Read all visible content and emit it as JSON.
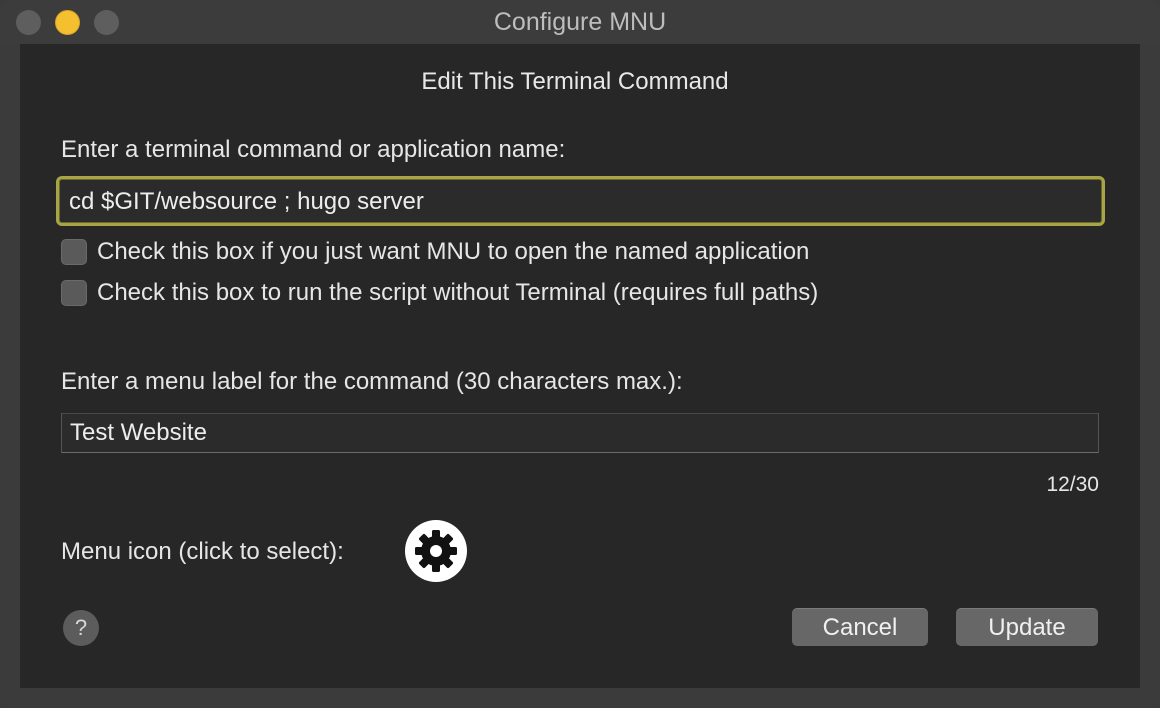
{
  "window": {
    "title": "Configure MNU"
  },
  "dialog": {
    "heading": "Edit This Terminal Command",
    "command_label": "Enter a terminal command or application name:",
    "command_value": "cd $GIT/websource ; hugo server",
    "checkboxes": [
      {
        "label": "Check this box if you just want MNU to open the named application",
        "checked": false
      },
      {
        "label": "Check this box to run the script without Terminal (requires full paths)",
        "checked": false
      }
    ],
    "menu_label_prompt": "Enter a menu label for the command (30 characters max.):",
    "menu_label_value": "Test Website",
    "char_counter": "12/30",
    "icon_label": "Menu icon (click to select):",
    "icon_name": "gear-icon"
  },
  "buttons": {
    "help": "?",
    "cancel": "Cancel",
    "update": "Update"
  },
  "colors": {
    "focus_ring": "#a8a448",
    "minimize_light": "#f5c02f",
    "panel_bg": "#272727",
    "button_bg": "#676767"
  }
}
